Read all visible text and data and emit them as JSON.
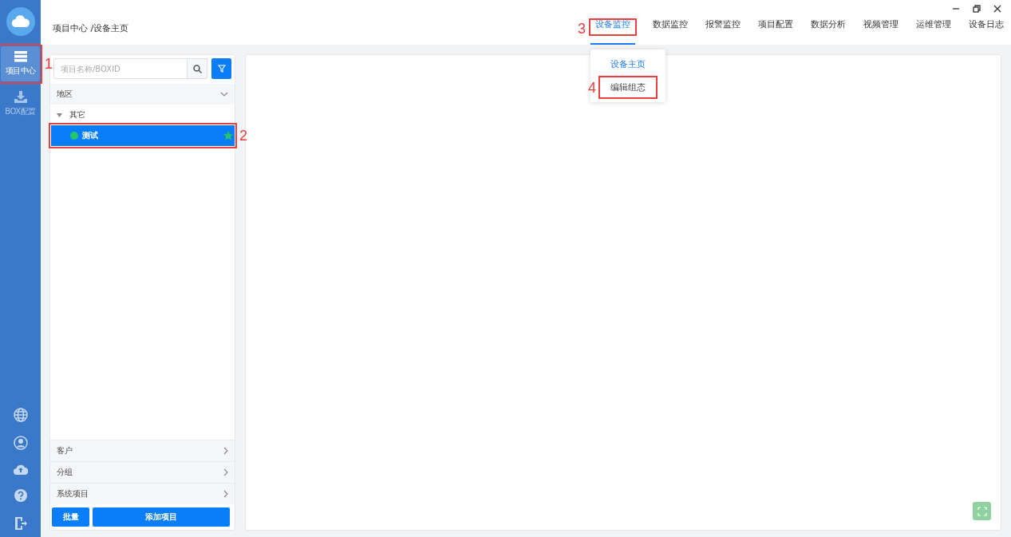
{
  "breadcrumb": "项目中心 /设备主页",
  "sidebar": {
    "items": [
      {
        "label": "项目中心",
        "kind": "list",
        "selected": true,
        "annotation": "1"
      },
      {
        "label": "BOX配置",
        "kind": "download",
        "selected": false
      }
    ]
  },
  "tabs": [
    {
      "label": "设备监控",
      "selected": true,
      "annotation": "3"
    },
    {
      "label": "数据监控",
      "selected": false
    },
    {
      "label": "报警监控",
      "selected": false
    },
    {
      "label": "项目配置",
      "selected": false
    },
    {
      "label": "数据分析",
      "selected": false
    },
    {
      "label": "视频管理",
      "selected": false
    },
    {
      "label": "运维管理",
      "selected": false
    },
    {
      "label": "设备日志",
      "selected": false
    }
  ],
  "dropdown_menu": {
    "items": [
      {
        "label": "设备主页",
        "selected": true
      },
      {
        "label": "编辑组态",
        "selected": false,
        "annotation": "4"
      }
    ]
  },
  "search": {
    "placeholder": "项目名称/BOXID"
  },
  "sections": [
    {
      "label": "地区",
      "expanded": true,
      "tree": [
        {
          "label": "其它",
          "expanded": true,
          "children": [
            {
              "label": "测试",
              "selected": true,
              "online": true,
              "starred": true,
              "annotation": "2"
            }
          ]
        }
      ]
    },
    {
      "label": "客户",
      "expanded": false
    },
    {
      "label": "分组",
      "expanded": false
    },
    {
      "label": "系统项目",
      "expanded": false
    }
  ],
  "buttons": {
    "batch": "批量",
    "add": "添加项目"
  }
}
